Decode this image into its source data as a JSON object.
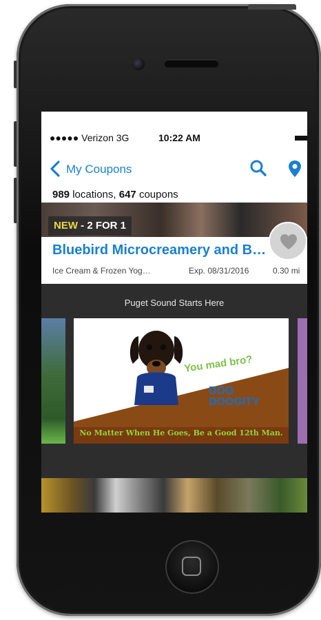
{
  "status_bar": {
    "carrier": "●●●●● Verizon  3G",
    "time": "10:22 AM"
  },
  "nav": {
    "back_label": "My Coupons",
    "icons": [
      "chevron-left-icon",
      "search-icon",
      "map-pin-icon"
    ]
  },
  "summary": {
    "locations_count": "989",
    "locations_label": " locations, ",
    "coupons_count": "647",
    "coupons_label": " coupons"
  },
  "coupon": {
    "badge_new": "NEW",
    "badge_deal": " - 2 FOR 1",
    "title": "Bluebird Microcreamery and B…",
    "category": "Ice Cream & Frozen Yog…",
    "expiration": "Exp. 08/31/2016",
    "distance": "0.30 mi",
    "favorite_icon": "heart-icon"
  },
  "ad_section": {
    "header": "Puget Sound Starts Here",
    "main_ad": {
      "callout": "You mad bro?",
      "logo_line1": "DOG",
      "logo_line2": "DOOGITY",
      "tagline": "No Matter When He Goes, Be a Good 12th Man."
    }
  },
  "colors": {
    "accent": "#1a7fd0",
    "badge_new": "#e8d84a",
    "dark_bg": "#2d2d2d",
    "ad_green": "#8fd63a"
  }
}
